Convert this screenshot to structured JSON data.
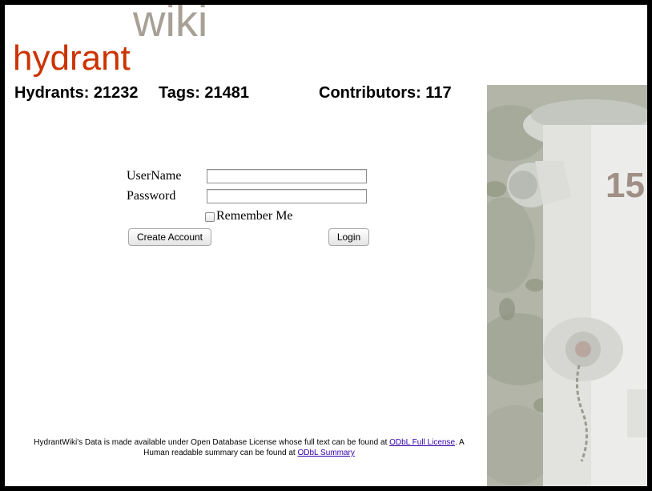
{
  "logo": {
    "wiki": "wiki",
    "hydrant": "hydrant"
  },
  "stats": {
    "hydrants": "Hydrants: 21232",
    "tags": "Tags: 21481",
    "contributors": "Contributors: 117"
  },
  "login": {
    "username_label": "UserName",
    "password_label": "Password",
    "username_value": "",
    "password_value": "",
    "remember_label": "Remember Me",
    "remember_checked": false,
    "create_account_label": "Create Account",
    "login_label": "Login"
  },
  "footer": {
    "text1": "HydrantWiki's Data is made available under Open Database License whose full text can be found at ",
    "link1": "ODbL Full License",
    "text2": ". A Human readable summary can be found at ",
    "link2": "ODbL Summary"
  },
  "colors": {
    "hydrant_logo": "#cc3300",
    "wiki_logo": "#a8a095",
    "link": "#3300aa"
  }
}
